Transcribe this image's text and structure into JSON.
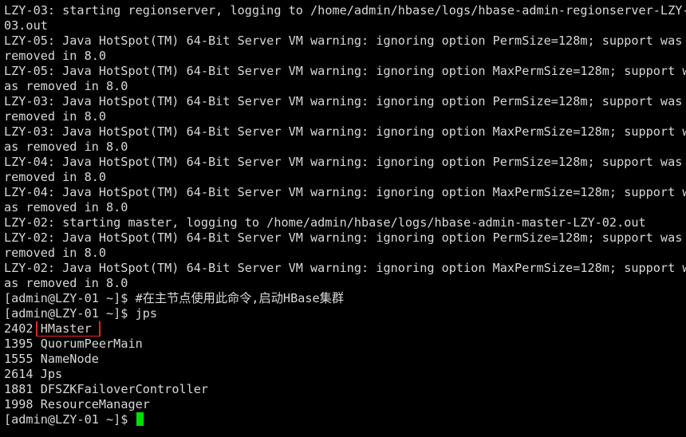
{
  "terminal": {
    "log_lines": [
      "LZY-03: starting regionserver, logging to /home/admin/hbase/logs/hbase-admin-regionserver-LZY-",
      "03.out",
      "LZY-05: Java HotSpot(TM) 64-Bit Server VM warning: ignoring option PermSize=128m; support was",
      "removed in 8.0",
      "LZY-05: Java HotSpot(TM) 64-Bit Server VM warning: ignoring option MaxPermSize=128m; support w",
      "as removed in 8.0",
      "LZY-03: Java HotSpot(TM) 64-Bit Server VM warning: ignoring option PermSize=128m; support was",
      "removed in 8.0",
      "LZY-03: Java HotSpot(TM) 64-Bit Server VM warning: ignoring option MaxPermSize=128m; support w",
      "as removed in 8.0",
      "LZY-04: Java HotSpot(TM) 64-Bit Server VM warning: ignoring option PermSize=128m; support was",
      "removed in 8.0",
      "LZY-04: Java HotSpot(TM) 64-Bit Server VM warning: ignoring option MaxPermSize=128m; support w",
      "as removed in 8.0",
      "LZY-02: starting master, logging to /home/admin/hbase/logs/hbase-admin-master-LZY-02.out",
      "LZY-02: Java HotSpot(TM) 64-Bit Server VM warning: ignoring option PermSize=128m; support was",
      "removed in 8.0",
      "LZY-02: Java HotSpot(TM) 64-Bit Server VM warning: ignoring option MaxPermSize=128m; support w",
      "as removed in 8.0"
    ],
    "comment_line": "[admin@LZY-01 ~]$ #在主节点使用此命令,启动HBase集群",
    "jps_command_line": "[admin@LZY-01 ~]$ jps",
    "jps_output": [
      {
        "pid": "2402",
        "name": "HMaster"
      },
      {
        "pid": "1395",
        "name": "QuorumPeerMain"
      },
      {
        "pid": "1555",
        "name": "NameNode"
      },
      {
        "pid": "2614",
        "name": "Jps"
      },
      {
        "pid": "1881",
        "name": "DFSZKFailoverController"
      },
      {
        "pid": "1998",
        "name": "ResourceManager"
      }
    ],
    "final_prompt": "[admin@LZY-01 ~]$ ",
    "colors": {
      "background": "#000000",
      "text": "#d8d8d8",
      "highlight_box": "#e0262b",
      "cursor": "#00e000"
    }
  }
}
